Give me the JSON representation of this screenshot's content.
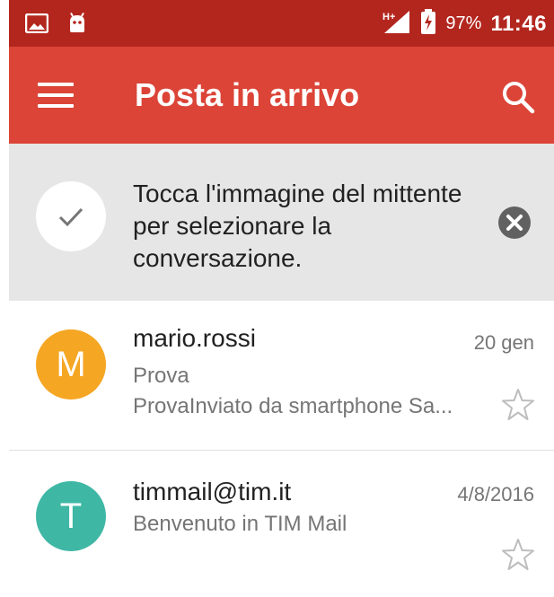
{
  "status_bar": {
    "icons_left": [
      "image-icon",
      "android-icon"
    ],
    "icons_right": [
      "signal-h-plus-icon",
      "battery-charging-icon"
    ],
    "battery": "97%",
    "time": "11:46"
  },
  "app_bar": {
    "title": "Posta in arrivo",
    "menu_icon": "hamburger-menu-icon",
    "search_icon": "search-icon",
    "color": "#db4437"
  },
  "tip": {
    "text": "Tocca l'immagine del mittente per selezionare la conversazione.",
    "check_icon": "check-icon",
    "close_icon": "close-circle-icon",
    "background": "#e6e6e6"
  },
  "emails": [
    {
      "avatar_letter": "M",
      "avatar_color": "#f5a623",
      "sender": "mario.rossi",
      "date": "20 gen",
      "subject": "Prova",
      "snippet": "ProvaInviato da smartphone Sa...",
      "starred": false
    },
    {
      "avatar_letter": "T",
      "avatar_color": "#3fb7a5",
      "sender": "timmail@tim.it",
      "date": "4/8/2016",
      "subject": "Benvenuto in TIM Mail",
      "snippet": "",
      "starred": false
    }
  ]
}
